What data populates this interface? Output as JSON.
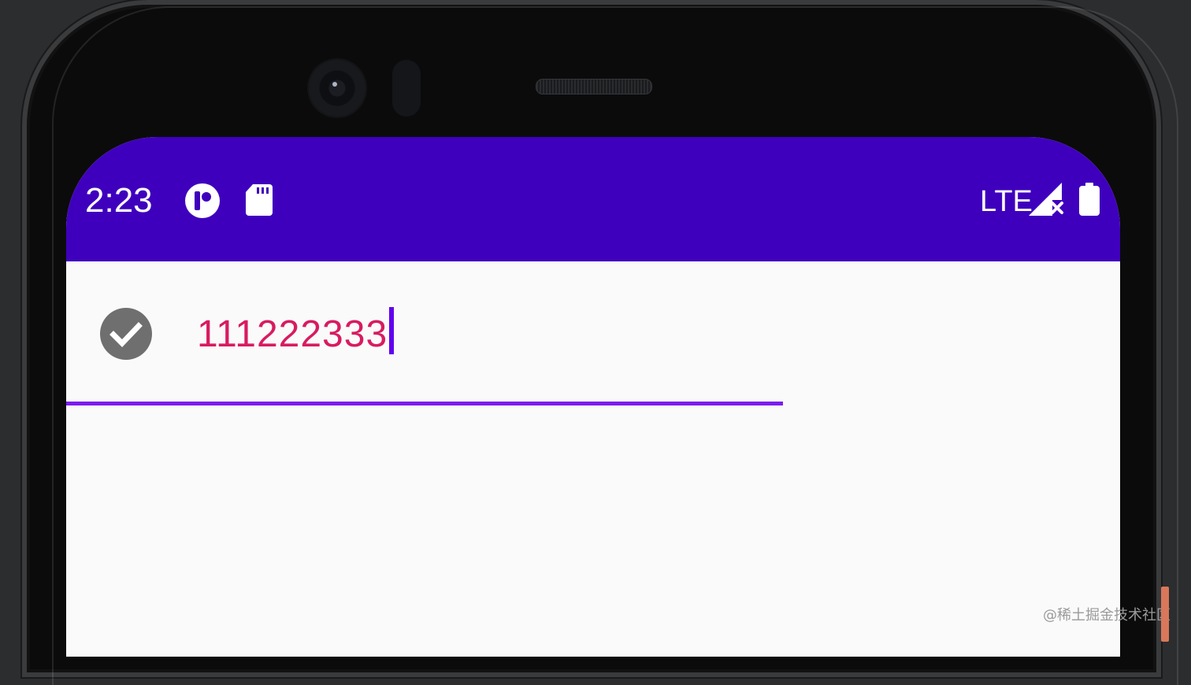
{
  "status_bar": {
    "time": "2:23",
    "network": "LTE",
    "icons": [
      "app-indicator-icon",
      "sd-card-icon",
      "signal-no-connection-icon",
      "battery-full-icon"
    ]
  },
  "text_field": {
    "value": "111222333",
    "leading_icon": "check-circle-icon",
    "value_color": "#d81b60",
    "cursor_color": "#6200ee",
    "underline_color": "#7c1cf0"
  },
  "colors": {
    "status_bar": "#3f00bd",
    "screen_background": "#fafafa",
    "phone_frame": "#0b0b0c"
  },
  "watermark": "@稀土掘金技术社区"
}
